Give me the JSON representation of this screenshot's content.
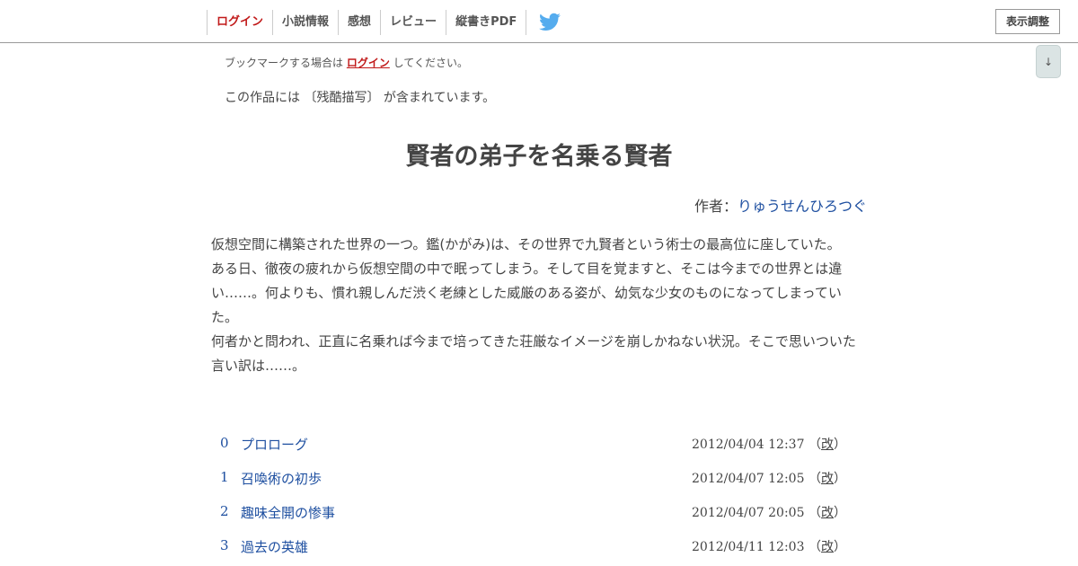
{
  "nav": {
    "items": [
      "ログイン",
      "小説情報",
      "感想",
      "レビュー",
      "縦書きPDF"
    ],
    "twitter_icon": "twitter-bird-icon",
    "display_settings": "表示調整"
  },
  "scroll_button": "↓",
  "bookmark_note": {
    "before": "ブックマークする場合は ",
    "link": "ログイン",
    "after": " してください。"
  },
  "content_warning": "この作品には 〔残酷描写〕 が含まれています。",
  "novel": {
    "title": "賢者の弟子を名乗る賢者",
    "author_label": "作者：",
    "author_name": "りゅうせんひろつぐ",
    "summary": [
      "仮想空間に構築された世界の一つ。鑑(かがみ)は、その世界で九賢者という術士の最高位に座していた。",
      "ある日、徹夜の疲れから仮想空間の中で眠ってしまう。そして目を覚ますと、そこは今までの世界とは違い……。何よりも、慣れ親しんだ渋く老練とした威厳のある姿が、幼気な少女のものになってしまっていた。",
      "何者かと問われ、正直に名乗れば今まで培ってきた荘厳なイメージを崩しかねない状況。そこで思いついた言い訳は……。"
    ]
  },
  "chapters": [
    {
      "num": "0",
      "title": "プロローグ",
      "date": "2012/04/04 12:37",
      "revised": "改"
    },
    {
      "num": "1",
      "title": "召喚術の初歩",
      "date": "2012/04/07 12:05",
      "revised": "改"
    },
    {
      "num": "2",
      "title": "趣味全開の惨事",
      "date": "2012/04/07 20:05",
      "revised": "改"
    },
    {
      "num": "3",
      "title": "過去の英雄",
      "date": "2012/04/11 12:03",
      "revised": "改"
    }
  ],
  "colors": {
    "login_red": "#c11a1a",
    "link_blue": "#1e4fa0",
    "twitter_blue": "#55acee"
  }
}
